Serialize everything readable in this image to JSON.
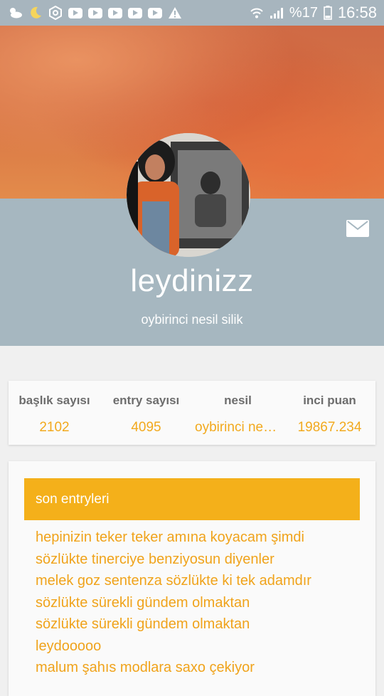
{
  "status_bar": {
    "battery_text": "%17",
    "time": "16:58"
  },
  "profile": {
    "username": "leydinizz",
    "generation": "oybirinci nesil silik"
  },
  "stats": [
    {
      "label": "başlık sayısı",
      "value": "2102"
    },
    {
      "label": "entry sayısı",
      "value": "4095"
    },
    {
      "label": "nesil",
      "value": "oybirinci nesil silik"
    },
    {
      "label": "inci puan",
      "value": "19867.234"
    }
  ],
  "entries": {
    "title": "son entryleri",
    "items": [
      "hepinizin teker teker amına koyacam şimdi",
      "sözlükte tinerciye benziyosun diyenler",
      "melek goz sentenza sözlükte ki tek adamdır",
      "sözlükte sürekli gündem olmaktan",
      "sözlükte sürekli gündem olmaktan",
      "leydooooo",
      "malum şahıs modlara saxo çekiyor"
    ]
  },
  "colors": {
    "accent": "#f4b01a",
    "header_bg": "#a6b7c0",
    "statusbar_bg": "#a7b5be"
  }
}
